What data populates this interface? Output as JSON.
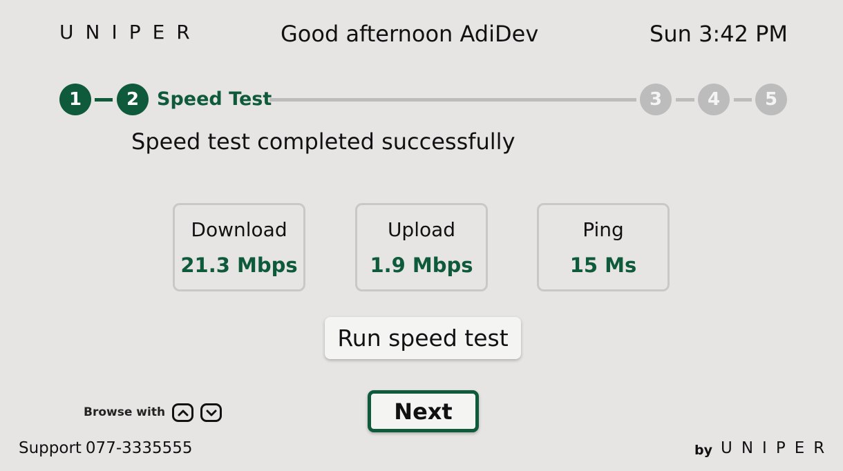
{
  "header": {
    "brand": "UNIPER",
    "greeting": "Good afternoon AdiDev",
    "clock": "Sun 3:42 PM"
  },
  "stepper": {
    "steps": [
      "1",
      "2",
      "3",
      "4",
      "5"
    ],
    "current_step": 2,
    "current_label": "Speed Test",
    "colors": {
      "done": "#0e5a3a",
      "todo": "#bdbcbc"
    }
  },
  "status_message": "Speed test completed successfully",
  "metrics": [
    {
      "title": "Download",
      "value": "21.3 Mbps"
    },
    {
      "title": "Upload",
      "value": "1.9 Mbps"
    },
    {
      "title": "Ping",
      "value": "15 Ms"
    }
  ],
  "buttons": {
    "run_speed_test": "Run speed test",
    "next": "Next"
  },
  "browse_hint": {
    "label": "Browse with",
    "keys": [
      "chevron-up-icon",
      "chevron-down-icon"
    ]
  },
  "footer": {
    "support_label": "Support",
    "support_number": "077-3335555",
    "by_label": "by",
    "brand": "UNIPER"
  },
  "colors": {
    "accent": "#0e5a3a",
    "background": "#e6e5e3"
  }
}
